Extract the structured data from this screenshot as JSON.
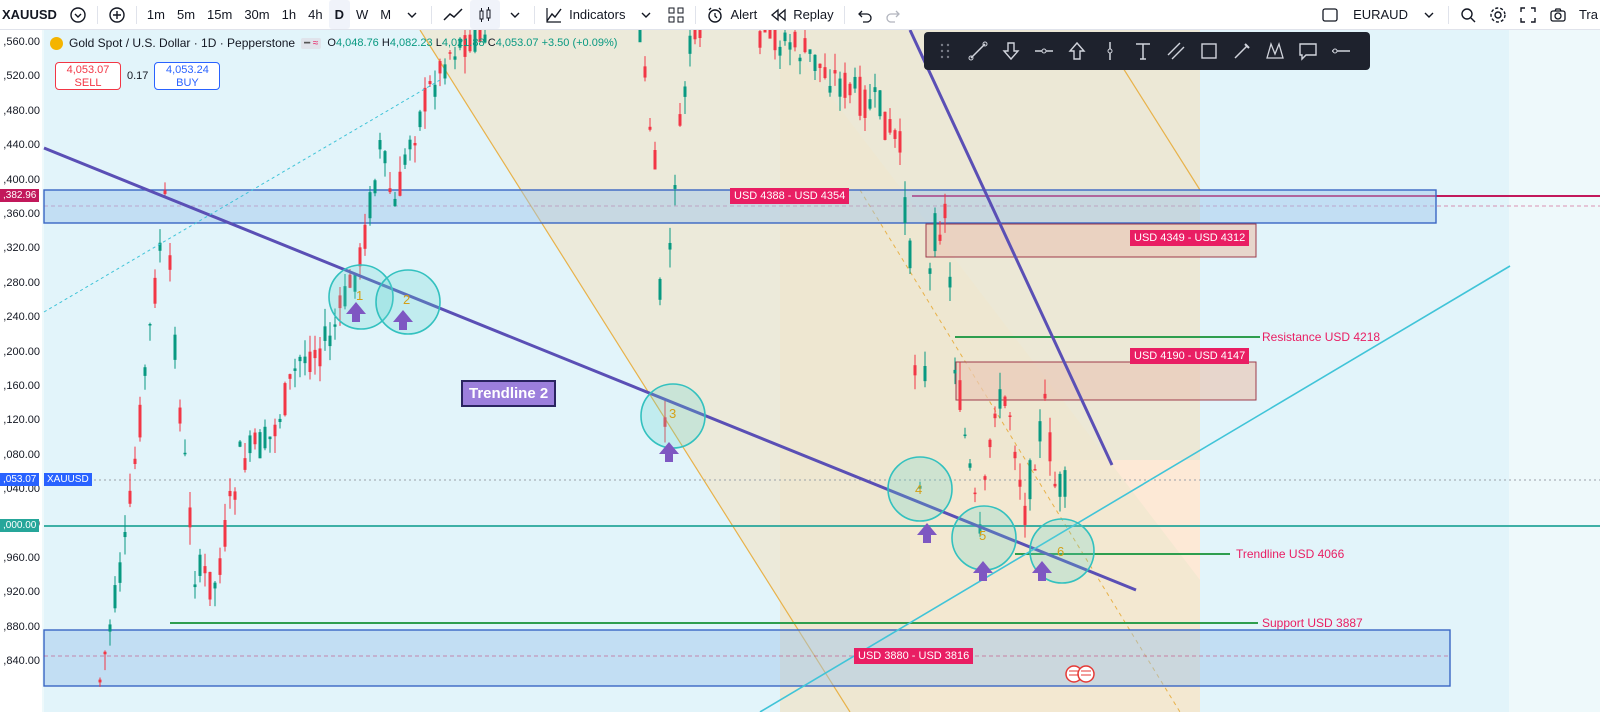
{
  "toolbar": {
    "symbol": "XAUUSD",
    "intervals": [
      "1m",
      "5m",
      "15m",
      "30m",
      "1h",
      "4h",
      "D",
      "W",
      "M"
    ],
    "active_interval": "D",
    "indicators_label": "Indicators",
    "alert_label": "Alert",
    "replay_label": "Replay",
    "compare_symbol": "EURAUD",
    "trade_label": "Tra"
  },
  "legend": {
    "title": "Gold Spot / U.S. Dollar · 1D · Pepperstone",
    "o_label": "O",
    "o_value": "4,048.76",
    "h_label": "H",
    "h_value": "4,082.23",
    "l_label": "L",
    "l_value": "4,021.88",
    "c_label": "C",
    "c_value": "4,053.07",
    "change": "+3.50 (+0.09%)"
  },
  "trade": {
    "sell_price": "4,053.07",
    "sell_label": "SELL",
    "spread": "0.17",
    "buy_price": "4,053.24",
    "buy_label": "BUY"
  },
  "price_axis": {
    "labels": [
      ",560.00",
      ",520.00",
      ",480.00",
      ",440.00",
      ",400.00",
      ",360.00",
      ",320.00",
      ",280.00",
      ",240.00",
      ",200.00",
      ",160.00",
      ",120.00",
      ",080.00",
      ",040.00",
      ",000.00",
      ",960.00",
      ",920.00",
      ",880.00",
      ",840.00"
    ],
    "current_price_tag": ",053.07",
    "symbol_tag": "XAUUSD",
    "resistance_tag": ",382.96",
    "level_tag": ",000.00"
  },
  "zones": {
    "zone_top": "USD 4388 - USD 4354",
    "zone_4349": "USD 4349 - USD 4312",
    "zone_4190": "USD 4190 - USD 4147",
    "zone_bottom": "USD 3880 - USD 3816"
  },
  "lines": {
    "resistance": "Resistance USD 4218",
    "trendline": "Trendline USD 4066",
    "support": "Support USD 3887",
    "trendline_box": "Trendline 2"
  },
  "touch_points": [
    "1",
    "2",
    "3",
    "4",
    "5",
    "6"
  ],
  "colors": {
    "accent_pink": "#e91e63",
    "trendline_purple": "#5a4fb5",
    "channel_cyan": "#40c4d8",
    "support_green": "#2e9e4e",
    "level_teal": "#26a69a",
    "arrow_purple": "#7e57c2"
  }
}
